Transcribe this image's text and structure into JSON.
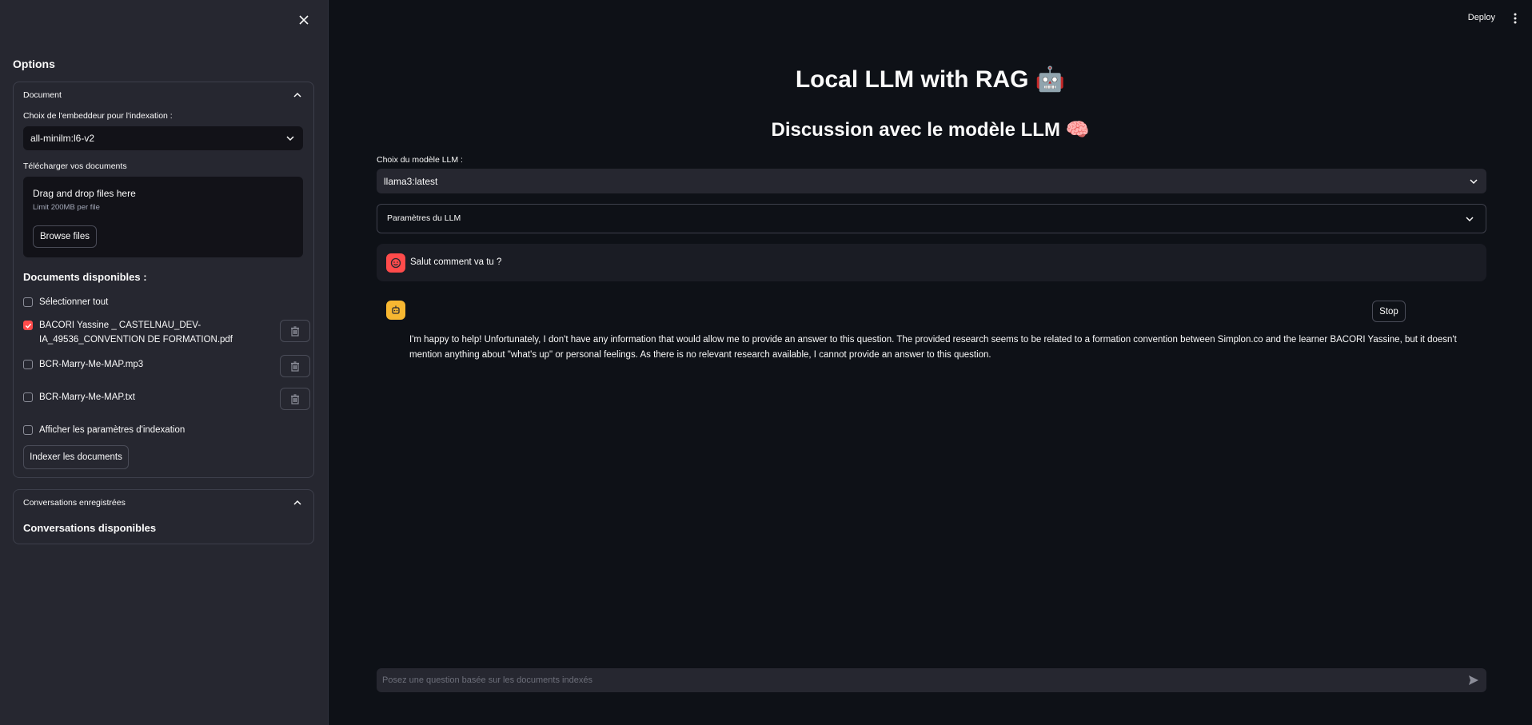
{
  "sidebar": {
    "heading": "Options",
    "document_expander": {
      "title": "Document",
      "embedder_label": "Choix de l'embeddeur pour l'indexation :",
      "embedder_value": "all-minilm:l6-v2",
      "upload_label": "Télécharger vos documents",
      "dropzone_title": "Drag and drop files here",
      "dropzone_limit": "Limit 200MB per file",
      "browse_button": "Browse files",
      "available_title": "Documents disponibles :",
      "select_all_label": "Sélectionner tout",
      "documents": [
        {
          "line1": "BACORI Yassine _ CASTELNAU_DEV-",
          "line2": "IA_49536_CONVENTION DE FORMATION.pdf",
          "checked": true
        },
        {
          "line1": "BCR-Marry-Me-MAP.mp3",
          "line2": "",
          "checked": false
        },
        {
          "line1": "BCR-Marry-Me-MAP.txt",
          "line2": "",
          "checked": false
        }
      ],
      "show_params_label": "Afficher les paramètres d'indexation",
      "index_button": "Indexer les documents"
    },
    "conversations_expander": {
      "title": "Conversations enregistrées",
      "subtitle": "Conversations disponibles"
    }
  },
  "header": {
    "deploy_label": "Deploy"
  },
  "main": {
    "title": "Local LLM with RAG 🤖",
    "subtitle": "Discussion avec le modèle LLM 🧠",
    "model_label": "Choix du modèle LLM :",
    "model_value": "llama3:latest",
    "params_expander": "Paramètres du LLM",
    "messages": {
      "user": "Salut comment va tu ?",
      "assistant": "I'm happy to help! Unfortunately, I don't have any information that would allow me to provide an answer to this question. The provided research seems to be related to a formation convention between Simplon.co and the learner BACORI Yassine, but it doesn't mention anything about \"what's up\" or personal feelings. As there is no relevant research available, I cannot provide an answer to this question."
    },
    "stop_button": "Stop",
    "chat_placeholder": "Posez une question basée sur les documents indexés"
  },
  "colors": {
    "accent": "#ff4b4b",
    "assistant_avatar": "#f7b731",
    "sidebar_bg": "#262730",
    "main_bg": "#0e1117"
  }
}
